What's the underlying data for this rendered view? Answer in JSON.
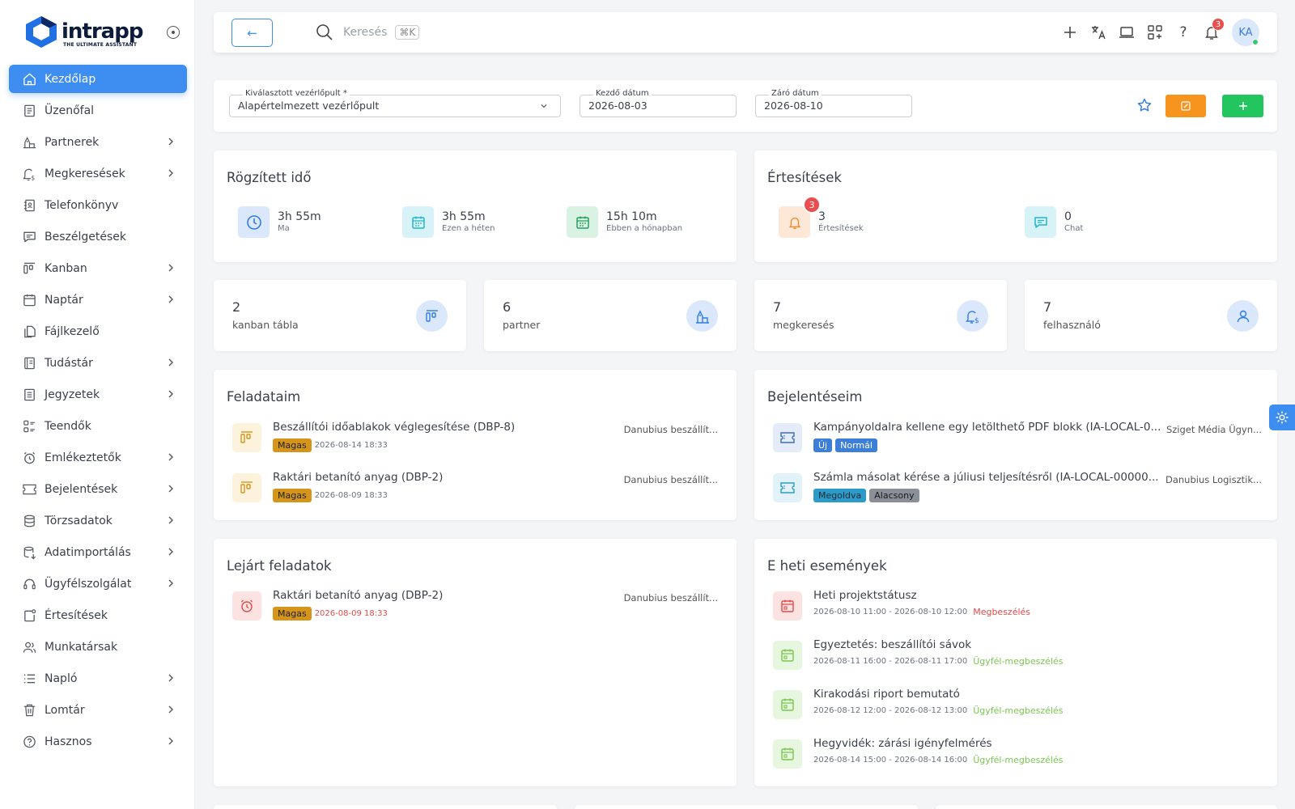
{
  "app": {
    "brand": "intrapp",
    "tagline": "THE ULTIMATE ASSISTANT"
  },
  "sidebar": {
    "items": [
      {
        "label": "Kezdőlap",
        "icon": "home-icon",
        "active": true,
        "chevron": false
      },
      {
        "label": "Üzenőfal",
        "icon": "board-icon",
        "chevron": false
      },
      {
        "label": "Partnerek",
        "icon": "partners-icon",
        "chevron": true
      },
      {
        "label": "Megkeresések",
        "icon": "bell-dollar-icon",
        "chevron": true
      },
      {
        "label": "Telefonkönyv",
        "icon": "phonebook-icon",
        "chevron": false
      },
      {
        "label": "Beszélgetések",
        "icon": "chat-icon",
        "chevron": false
      },
      {
        "label": "Kanban",
        "icon": "kanban-icon",
        "chevron": true
      },
      {
        "label": "Naptár",
        "icon": "calendar-icon",
        "chevron": true
      },
      {
        "label": "Fájlkezelő",
        "icon": "files-icon",
        "chevron": false
      },
      {
        "label": "Tudástár",
        "icon": "book-icon",
        "chevron": true
      },
      {
        "label": "Jegyzetek",
        "icon": "notes-icon",
        "chevron": true
      },
      {
        "label": "Teendők",
        "icon": "todo-icon",
        "chevron": false
      },
      {
        "label": "Emlékeztetők",
        "icon": "alarm-icon",
        "chevron": true
      },
      {
        "label": "Bejelentések",
        "icon": "ticket-icon",
        "chevron": true
      },
      {
        "label": "Törzsadatok",
        "icon": "database-icon",
        "chevron": true
      },
      {
        "label": "Adatimportálás",
        "icon": "import-icon",
        "chevron": true
      },
      {
        "label": "Ügyfélszolgálat",
        "icon": "headset-icon",
        "chevron": true
      },
      {
        "label": "Értesítések",
        "icon": "notification-icon",
        "chevron": false
      },
      {
        "label": "Munkatársak",
        "icon": "users-icon",
        "chevron": false
      },
      {
        "label": "Napló",
        "icon": "list-icon",
        "chevron": true
      },
      {
        "label": "Lomtár",
        "icon": "trash-icon",
        "chevron": true
      },
      {
        "label": "Hasznos",
        "icon": "help-circle-icon",
        "chevron": true
      }
    ]
  },
  "topbar": {
    "back_icon": "←",
    "search_placeholder": "Keresés",
    "search_shortcut": "⌘K",
    "notification_count": "3",
    "avatar_initials": "KA"
  },
  "filters": {
    "dashboard_label": "Kiválasztott vezérlőpult *",
    "dashboard_value": "Alapértelmezett vezérlőpult",
    "start_label": "Kezdő dátum",
    "start_value": "2026-08-03",
    "end_label": "Záró dátum",
    "end_value": "2026-08-10"
  },
  "recorded_time": {
    "title": "Rögzített idő",
    "stats": [
      {
        "value": "3h 55m",
        "label": "Ma"
      },
      {
        "value": "3h 55m",
        "label": "Ezen a héten"
      },
      {
        "value": "15h 10m",
        "label": "Ebben a hónapban"
      }
    ]
  },
  "notifications": {
    "title": "Értesítések",
    "stats": [
      {
        "value": "3",
        "label": "Értesítések",
        "badge": "3"
      },
      {
        "value": "0",
        "label": "Chat"
      }
    ]
  },
  "minis": [
    {
      "value": "2",
      "label": "kanban tábla",
      "icon": "kanban-icon"
    },
    {
      "value": "6",
      "label": "partner",
      "icon": "partners-icon"
    },
    {
      "value": "7",
      "label": "megkeresés",
      "icon": "bell-dollar-icon"
    },
    {
      "value": "7",
      "label": "felhasználó",
      "icon": "user-icon"
    }
  ],
  "my_tasks": {
    "title": "Feladataim",
    "rows": [
      {
        "title": "Beszállítói időablakok véglegesítése (DBP-8)",
        "priority": "Magas",
        "date": "2026-08-14 18:33",
        "partner": "Danubius beszállít..."
      },
      {
        "title": "Raktári betanító anyag (DBP-2)",
        "priority": "Magas",
        "date": "2026-08-09 18:33",
        "partner": "Danubius beszállít..."
      }
    ]
  },
  "my_tickets": {
    "title": "Bejelentéseim",
    "rows": [
      {
        "title": "Kampányoldalra kellene egy letölthető PDF blokk (IA-LOCAL-0...",
        "status": "Új",
        "priority": "Normál",
        "partner": "Sziget Média Ügyn..."
      },
      {
        "title": "Számla másolat kérése a júliusi teljesítésről (IA-LOCAL-00000...",
        "status": "Megoldva",
        "priority": "Alacsony",
        "partner": "Danubius Logisztik..."
      }
    ]
  },
  "overdue": {
    "title": "Lejárt feladatok",
    "rows": [
      {
        "title": "Raktári betanító anyag (DBP-2)",
        "priority": "Magas",
        "date": "2026-08-09 18:33",
        "partner": "Danubius beszállít..."
      }
    ]
  },
  "events": {
    "title": "E heti események",
    "rows": [
      {
        "title": "Heti projektstátusz",
        "time": "2026-08-10 11:00 - 2026-08-10 12:00",
        "type": "Megbeszélés"
      },
      {
        "title": "Egyeztetés: beszállítói sávok",
        "time": "2026-08-11 16:00 - 2026-08-11 17:00",
        "type": "Ügyfél-megbeszélés"
      },
      {
        "title": "Kirakodási riport bemutató",
        "time": "2026-08-12 12:00 - 2026-08-12 13:00",
        "type": "Ügyfél-megbeszélés"
      },
      {
        "title": "Hegyvidék: zárási igényfelmérés",
        "time": "2026-08-14 15:00 - 2026-08-14 16:00",
        "type": "Ügyfél-megbeszélés"
      }
    ]
  },
  "colors": {
    "accent": "#3d8ef0",
    "orange": "#f7941d",
    "green": "#22c55e",
    "priority_high": "#d4951a",
    "status_new": "#3d7ed8",
    "status_solved": "#2d9bc7",
    "priority_low": "#8a8f98",
    "overdue_red": "#e04b4b",
    "meeting_red": "#e04b4b",
    "client_meeting_green": "#7ac74f"
  }
}
